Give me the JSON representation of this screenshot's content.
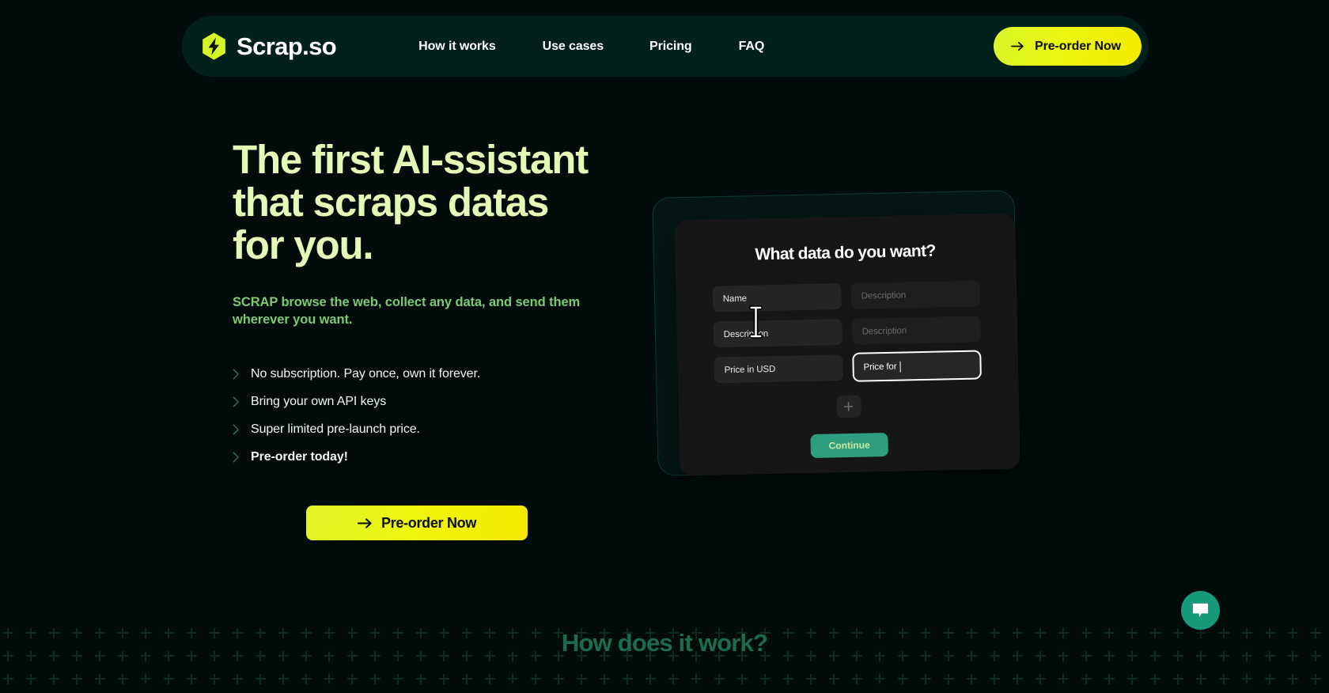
{
  "brand": {
    "name": "Scrap.so",
    "logo_icon": "lightning-hexagon-icon",
    "logo_color": "#d5f528"
  },
  "nav": {
    "items": [
      {
        "label": "How it works"
      },
      {
        "label": "Use cases"
      },
      {
        "label": "Pricing"
      },
      {
        "label": "FAQ"
      }
    ],
    "cta": {
      "label": "Pre-order Now",
      "icon": "arrow-right-icon",
      "bg_gradient_from": "#d8f52a",
      "bg_gradient_to": "#f4ea00"
    }
  },
  "hero": {
    "title": "The first AI-ssistant\nthat scraps datas\nfor you.",
    "title_color": "#e7f7b6",
    "subtitle": "SCRAP browse the web, collect any data, and send them wherever you want.",
    "subtitle_color": "#7ec972",
    "features": [
      {
        "label": "No subscription. Pay once, own it forever.",
        "bold": false,
        "icon": "chevron-right-icon"
      },
      {
        "label": "Bring your own API keys",
        "bold": false,
        "icon": "chevron-right-icon"
      },
      {
        "label": "Super limited pre-launch price.",
        "bold": false,
        "icon": "chevron-right-icon"
      },
      {
        "label": "Pre-order today!",
        "bold": true,
        "icon": "chevron-right-icon"
      }
    ],
    "cta": {
      "label": "Pre-order Now",
      "icon": "arrow-right-icon"
    }
  },
  "mockup": {
    "title": "What data do you want?",
    "fields": [
      {
        "value": "Name",
        "state": "filled",
        "placeholder": ""
      },
      {
        "value": "Description",
        "state": "placeholder",
        "placeholder": "Description"
      },
      {
        "value": "Description",
        "state": "filled",
        "placeholder": ""
      },
      {
        "value": "Description",
        "state": "placeholder",
        "placeholder": "Description"
      },
      {
        "value": "Price in USD",
        "state": "filled",
        "placeholder": ""
      },
      {
        "value": "Price for",
        "state": "focused",
        "placeholder": ""
      }
    ],
    "add_button": {
      "icon": "plus-icon",
      "label": ""
    },
    "continue_button": {
      "label": "Continue",
      "color": "#2f9e7e"
    },
    "cursor": "text-ibeam-cursor"
  },
  "section": {
    "title": "How does it work?",
    "title_color": "#1d6a53"
  },
  "chat": {
    "icon": "chat-bubble-icon",
    "bg_color": "#17997b"
  },
  "theme": {
    "page_bg": "#020d0b",
    "header_bg": "#03201c",
    "accent_yellow": "#eaf612",
    "accent_green": "#17997b"
  }
}
